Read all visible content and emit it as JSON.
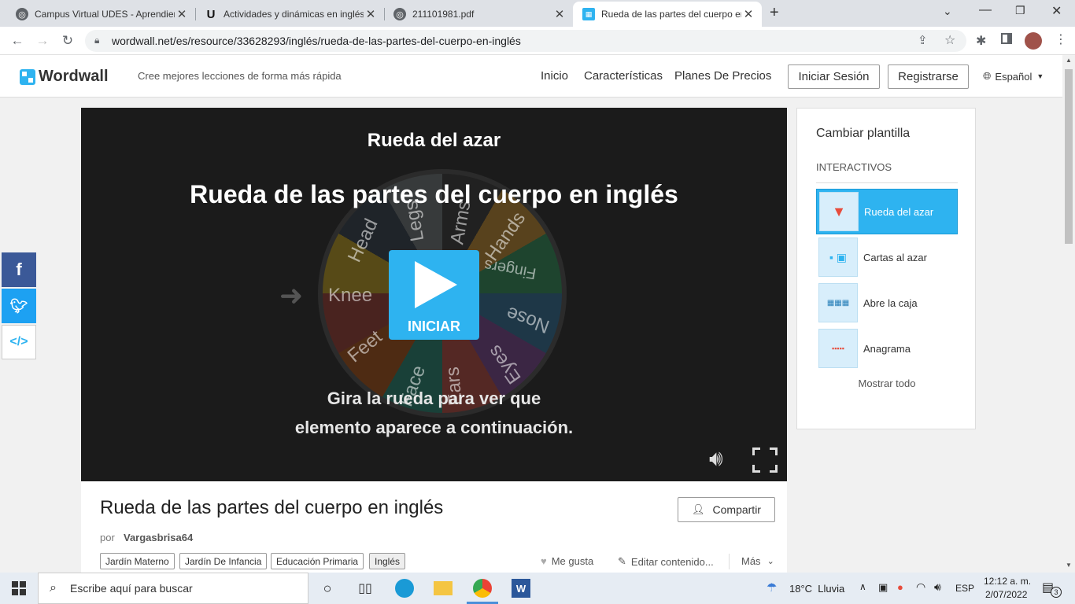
{
  "browser": {
    "tabs": [
      {
        "title": "Campus Virtual UDES - Aprendiendo",
        "icon": "globe-icon"
      },
      {
        "title": "Actividades y dinámicas en inglés",
        "icon": "u-logo-icon"
      },
      {
        "title": "211101981.pdf",
        "icon": "globe-icon"
      },
      {
        "title": "Rueda de las partes del cuerpo en inglés",
        "icon": "wordwall-icon"
      }
    ],
    "new_tab": "+",
    "url": "wordwall.net/es/resource/33628293/inglés/rueda-de-las-partes-del-cuerpo-en-inglés"
  },
  "site": {
    "logo": "Wordwall",
    "tagline": "Cree mejores lecciones de forma más rápida",
    "nav": [
      "Inicio",
      "Características",
      "Planes De Precios"
    ],
    "login": "Iniciar Sesión",
    "register": "Registrarse",
    "language": "Español"
  },
  "game": {
    "template_name": "Rueda del azar",
    "title": "Rueda de las partes del cuerpo en inglés",
    "wheel_items": [
      "Head",
      "Legs",
      "Arms",
      "Hands",
      "Fingers",
      "Nose",
      "Eyes",
      "Ears",
      "Face",
      "Feet",
      "Knee"
    ],
    "start": "INICIAR",
    "instruction_line1": "Gira la rueda para ver que",
    "instruction_line2": "elemento aparece a continuación."
  },
  "panel": {
    "heading": "Cambiar plantilla",
    "section": "INTERACTIVOS",
    "templates": [
      "Rueda del azar",
      "Cartas al azar",
      "Abre la caja",
      "Anagrama"
    ],
    "show_all": "Mostrar todo"
  },
  "info": {
    "title": "Rueda de las partes del cuerpo en inglés",
    "share": "Compartir",
    "by": "por",
    "author": "Vargasbrisa64",
    "tags": [
      "Jardín Materno",
      "Jardín De Infancia",
      "Educación Primaria",
      "Inglés"
    ],
    "like": "Me gusta",
    "edit": "Editar contenido...",
    "more": "Más"
  },
  "taskbar": {
    "search_placeholder": "Escribe aquí para buscar",
    "weather": "18°C  Lluvia",
    "lang": "ESP",
    "time": "12:12 a. m.",
    "date": "2/07/2022",
    "notifications": "3"
  }
}
